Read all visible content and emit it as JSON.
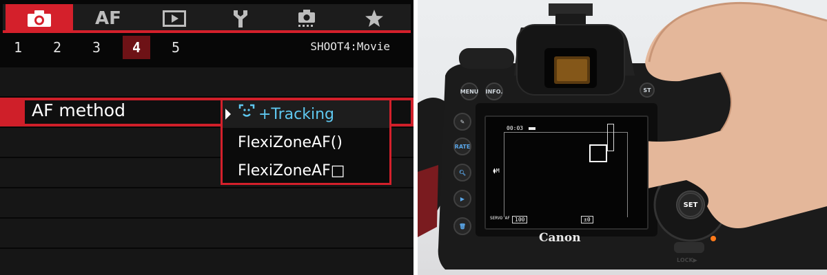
{
  "menu": {
    "tabs": [
      {
        "name": "shoot",
        "label": "",
        "icon": "camera-icon",
        "active": true
      },
      {
        "name": "af",
        "label": "AF",
        "icon": "",
        "active": false
      },
      {
        "name": "playback",
        "label": "",
        "icon": "play-icon",
        "active": false
      },
      {
        "name": "setup",
        "label": "",
        "icon": "wrench-icon",
        "active": false
      },
      {
        "name": "custom-functions",
        "label": "",
        "icon": "camera-custom-icon",
        "active": false
      },
      {
        "name": "my-menu",
        "label": "",
        "icon": "star-icon",
        "active": false
      }
    ],
    "subtabs": [
      "1",
      "2",
      "3",
      "4",
      "5"
    ],
    "active_subtab": "4",
    "page_label": "SHOOT4:Movie",
    "item_label": "AF method",
    "options": [
      "+Tracking",
      "FlexiZoneAF()",
      "FlexiZoneAF□"
    ],
    "selected_option": "+Tracking",
    "colors": {
      "accent_red": "#d4202b",
      "selected_blue": "#5fc8f0",
      "background": "#070707"
    }
  },
  "camera": {
    "brand": "Canon",
    "buttons": {
      "menu": "MENU",
      "info": "INFO.",
      "rate": "RATE",
      "set": "SET",
      "lock": "LOCK▶",
      "st": "ST"
    },
    "lcd": {
      "timer": "00:03",
      "af_mode": "SERVO AF",
      "iso": "100",
      "exposure": "±0"
    }
  }
}
